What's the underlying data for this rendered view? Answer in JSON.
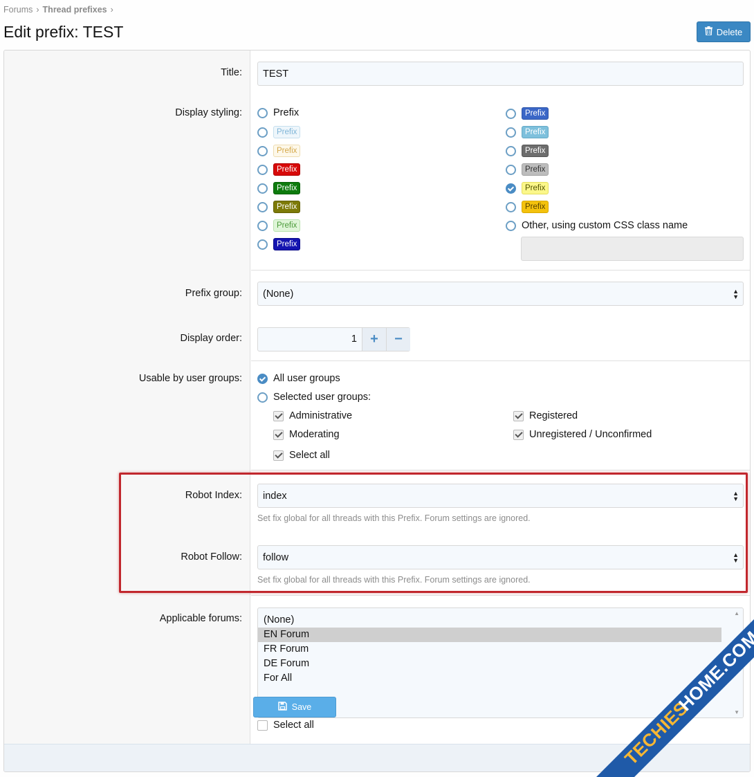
{
  "breadcrumb": [
    "Forums",
    "Thread prefixes"
  ],
  "page_title": "Edit prefix: TEST",
  "delete_label": "Delete",
  "fields": {
    "title_label": "Title:",
    "title_value": "TEST",
    "styling_label": "Display styling:",
    "styling_plain": "Prefix",
    "styling_badges_left": [
      {
        "text": "Prefix",
        "bg": "#eef6fb",
        "fg": "#7fb5d8",
        "border": "#c5dfee"
      },
      {
        "text": "Prefix",
        "bg": "#fdf8ea",
        "fg": "#d5a84a",
        "border": "#eeddb0"
      },
      {
        "text": "Prefix",
        "bg": "#d70a0a",
        "fg": "#ffffff",
        "border": "#b00000"
      },
      {
        "text": "Prefix",
        "bg": "#0d7b0d",
        "fg": "#ffffff",
        "border": "#066006"
      },
      {
        "text": "Prefix",
        "bg": "#7d7a08",
        "fg": "#ffffff",
        "border": "#626004"
      },
      {
        "text": "Prefix",
        "bg": "#dff5d8",
        "fg": "#4a9a38",
        "border": "#b8e2ad"
      },
      {
        "text": "Prefix",
        "bg": "#1414b0",
        "fg": "#ffffff",
        "border": "#0a0a88"
      }
    ],
    "styling_badges_right": [
      {
        "text": "Prefix",
        "bg": "#3b67c7",
        "fg": "#ffffff",
        "border": "#2d54a8",
        "checked": false
      },
      {
        "text": "Prefix",
        "bg": "#7ec0dc",
        "fg": "#ffffff",
        "border": "#65a9c6",
        "checked": false
      },
      {
        "text": "Prefix",
        "bg": "#6d6d6d",
        "fg": "#ffffff",
        "border": "#555555",
        "checked": false
      },
      {
        "text": "Prefix",
        "bg": "#bdbdbd",
        "fg": "#333333",
        "border": "#a3a3a3",
        "checked": false
      },
      {
        "text": "Prefix",
        "bg": "#fbf78a",
        "fg": "#555500",
        "border": "#e5df5c",
        "checked": true
      },
      {
        "text": "Prefix",
        "bg": "#f4c20d",
        "fg": "#5a4300",
        "border": "#d9a800",
        "checked": false
      }
    ],
    "styling_other": "Other, using custom CSS class name",
    "group_label": "Prefix group:",
    "group_value": "(None)",
    "order_label": "Display order:",
    "order_value": "1",
    "usergroups_label": "Usable by user groups:",
    "all_groups": "All user groups",
    "selected_groups": "Selected user groups:",
    "groups": [
      "Administrative",
      "Registered",
      "Moderating",
      "Unregistered / Unconfirmed"
    ],
    "select_all": "Select all",
    "robot_index_label": "Robot Index:",
    "robot_index_value": "index",
    "robot_index_explain": "Set fix global for all threads with this Prefix. Forum settings are ignored.",
    "robot_follow_label": "Robot Follow:",
    "robot_follow_value": "follow",
    "robot_follow_explain": "Set fix global for all threads with this Prefix. Forum settings are ignored.",
    "forums_label": "Applicable forums:",
    "forums": [
      "(None)",
      "EN Forum",
      "FR Forum",
      "DE Forum",
      "For All"
    ],
    "forums_select_all": "Select all"
  },
  "save_label": "Save",
  "watermark": "TECHIESHOME.COM",
  "colors": {
    "accent": "#3b88c3",
    "highlight": "#c1272d",
    "save": "#5aaee8",
    "watermark_bg": "#1f5aa8",
    "watermark_fg": "#f7b733"
  }
}
